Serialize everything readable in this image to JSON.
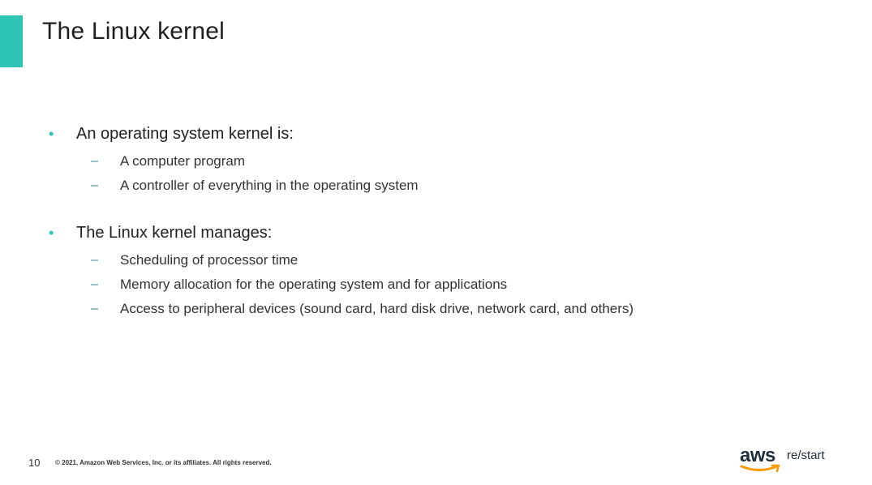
{
  "slide": {
    "title": "The Linux kernel",
    "page_number": "10",
    "copyright": "© 2021, Amazon Web Services, Inc. or its affiliates. All rights reserved."
  },
  "sections": [
    {
      "heading": "An operating system kernel is:",
      "items": [
        "A computer program",
        "A controller of everything in the operating system"
      ]
    },
    {
      "heading": "The Linux kernel manages:",
      "items": [
        "Scheduling of processor time",
        "Memory allocation for the operating system and for applications",
        "Access to peripheral devices (sound card, hard disk drive, network card, and others)"
      ]
    }
  ],
  "logo": {
    "brand": "aws",
    "product": "re/start",
    "icon": "aws-smile-icon"
  },
  "colors": {
    "accent": "#2ec4b6",
    "logo_dark": "#232f3e",
    "logo_orange": "#ff9900"
  }
}
